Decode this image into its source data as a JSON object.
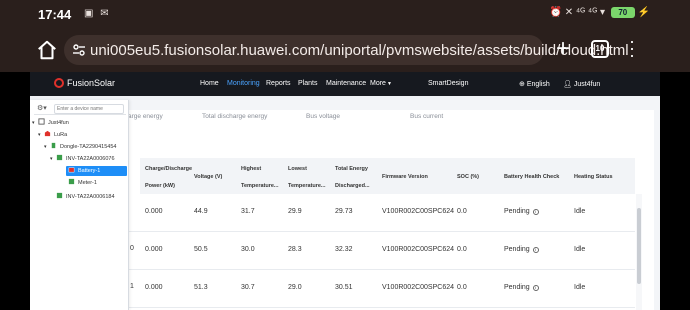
{
  "status_bar": {
    "time": "17:44",
    "left_icons": "▣ ✉",
    "right_icons": "⏰ ✕ ⁴ᴳ ⁴ᴳ ▾",
    "battery": "70"
  },
  "browser": {
    "url": "uni005eu5.fusionsolar.huawei.com/uniportal/pvmswebsite/assets/build/cloud.html",
    "tab_count": "10"
  },
  "nav": {
    "brand": "FusionSolar",
    "items": [
      "Home",
      "Monitoring",
      "Reports",
      "Plants",
      "Maintenance",
      "More"
    ],
    "active": "Monitoring",
    "smart_design": "SmartDesign",
    "language": "English",
    "user": "Just4fun"
  },
  "ghost_labels": [
    "arge energy",
    "Total discharge energy",
    "Bus voltage",
    "Bus current"
  ],
  "tree": {
    "search_placeholder": "Enter a device name",
    "nodes": [
      "Just4fun",
      "LuRa",
      "Dongle-TA2290415454",
      "INV-TA22A0006076",
      "Battery-1",
      "Meter-1",
      "INV-TA22A0006184"
    ],
    "selected": "Battery-1"
  },
  "table": {
    "headers": [
      [
        "Charge/Discharge",
        "Power (kW)"
      ],
      [
        "Voltage (V)"
      ],
      [
        "Highest",
        "Temperature..."
      ],
      [
        "Lowest",
        "Temperature..."
      ],
      [
        "Total Energy",
        "Discharged..."
      ],
      [
        "Firmware Version"
      ],
      [
        "SOC (%)"
      ],
      [
        "Battery Health Check"
      ],
      [
        "Heating Status"
      ]
    ],
    "left_digits": [
      "",
      "0",
      "1"
    ],
    "rows": [
      [
        "0.000",
        "44.9",
        "31.7",
        "29.9",
        "29.73",
        "V100R002C00SPC624",
        "0.0",
        "Pending",
        "Idle"
      ],
      [
        "0.000",
        "50.5",
        "30.0",
        "28.3",
        "32.32",
        "V100R002C00SPC624",
        "0.0",
        "Pending",
        "Idle"
      ],
      [
        "0.000",
        "51.3",
        "30.7",
        "29.0",
        "30.51",
        "V100R002C00SPC624",
        "0.0",
        "Pending",
        "Idle"
      ]
    ]
  }
}
